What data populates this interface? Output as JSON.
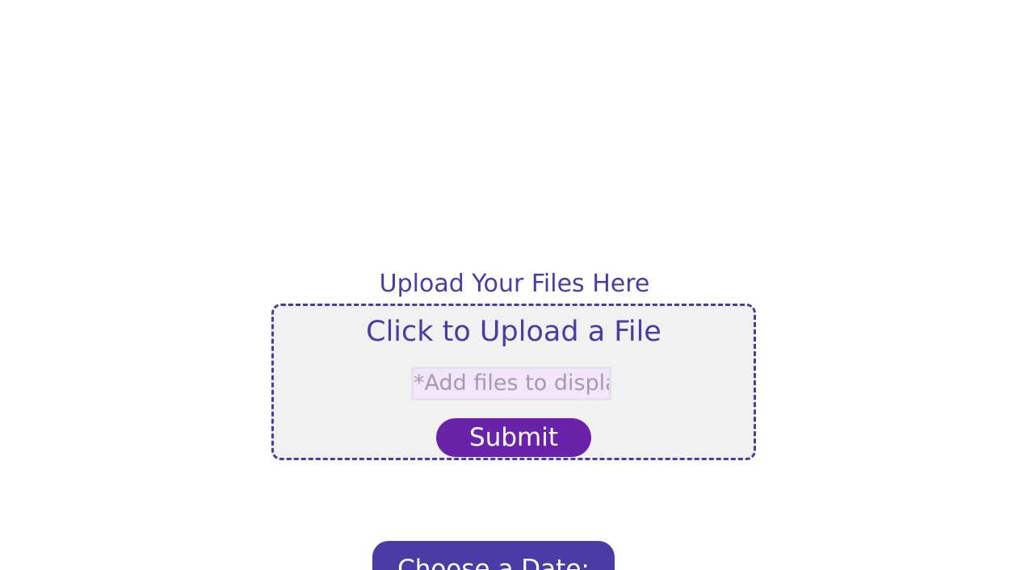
{
  "upload": {
    "heading": "Upload Your Files Here",
    "dropzone_title": "Click to Upload a File",
    "file_input_placeholder": "*Add files to display",
    "submit_label": "Submit"
  },
  "date_picker": {
    "button_label": "Choose a Date:"
  },
  "colors": {
    "accent": "#493ca3",
    "submit": "#6a22a8",
    "dropzone_bg": "#f1f1f1",
    "input_bg": "#f3e6fb"
  }
}
